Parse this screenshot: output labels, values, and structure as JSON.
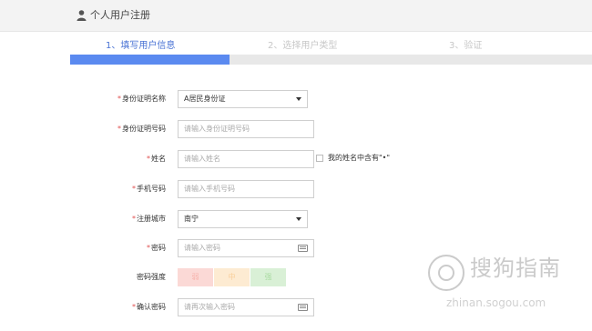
{
  "header": {
    "title": "个人用户注册",
    "icon": "user-icon"
  },
  "steps": {
    "items": [
      {
        "label": "1、填写用户信息",
        "state": "active"
      },
      {
        "label": "2、选择用户类型",
        "state": "inactive"
      },
      {
        "label": "3、验证",
        "state": "inactive"
      }
    ],
    "progress_fraction": 0.305,
    "active_color": "#4a73d4",
    "fill_color": "#5b8af0"
  },
  "form": {
    "id_type": {
      "label": "身份证明名称",
      "required": "*",
      "value": "A居民身份证"
    },
    "id_number": {
      "label": "身份证明号码",
      "required": "*",
      "placeholder": "请输入身份证明号码"
    },
    "name": {
      "label": "姓名",
      "required": "*",
      "placeholder": "请输入姓名",
      "checkbox_label": "我的姓名中含有\"•\""
    },
    "phone": {
      "label": "手机号码",
      "required": "*",
      "placeholder": "请输入手机号码"
    },
    "city": {
      "label": "注册城市",
      "required": "*",
      "value": "南宁"
    },
    "password": {
      "label": "密码",
      "required": "*",
      "placeholder": "请输入密码"
    },
    "strength": {
      "label": "密码强度",
      "weak": "弱",
      "medium": "中",
      "strong": "强"
    },
    "confirm": {
      "label": "确认密码",
      "required": "*",
      "placeholder": "请再次输入密码"
    }
  },
  "watermark": {
    "text": "搜狗指南",
    "url": "zhinan.sogou.com"
  }
}
